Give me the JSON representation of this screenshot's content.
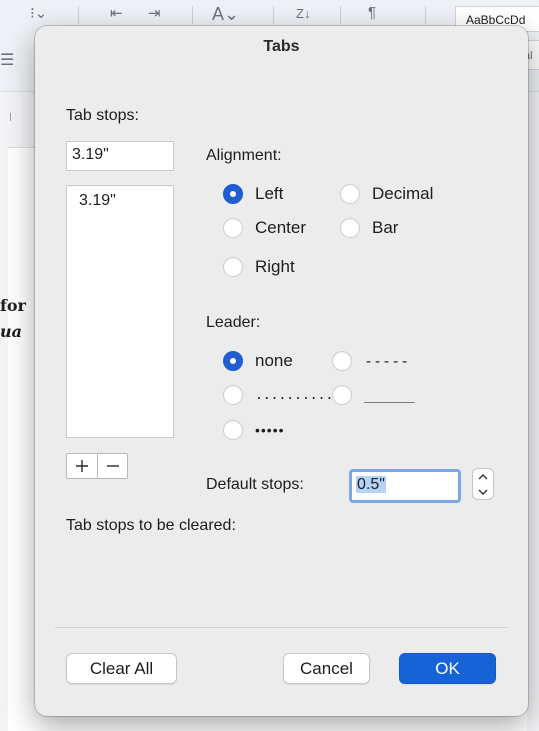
{
  "background_app": {
    "style_preview": "AaBbCcDd",
    "style_preview_2": "al",
    "doc_text_line1": "for",
    "doc_text_line2": "ua"
  },
  "dialog": {
    "title": "Tabs",
    "tab_stops_label": "Tab stops:",
    "tab_stop_value": "3.19\"",
    "tab_stops_list": [
      "3.19\""
    ],
    "add_button_icon": "plus-icon",
    "remove_button_icon": "minus-icon",
    "alignment": {
      "label": "Alignment:",
      "options": [
        "Left",
        "Decimal",
        "Center",
        "Bar",
        "Right"
      ],
      "selected": "Left"
    },
    "leader": {
      "label": "Leader:",
      "options": [
        "none",
        "-----",
        "..........",
        "______",
        "•••••"
      ],
      "selected": "none"
    },
    "default_stops": {
      "label": "Default stops:",
      "value": "0.5\""
    },
    "cleared_label": "Tab stops to be cleared:",
    "buttons": {
      "clear_all": "Clear All",
      "cancel": "Cancel",
      "ok": "OK"
    }
  },
  "colors": {
    "accent": "#1f5fd1",
    "primary_button": "#1563d6",
    "dialog_bg": "#ececec"
  }
}
